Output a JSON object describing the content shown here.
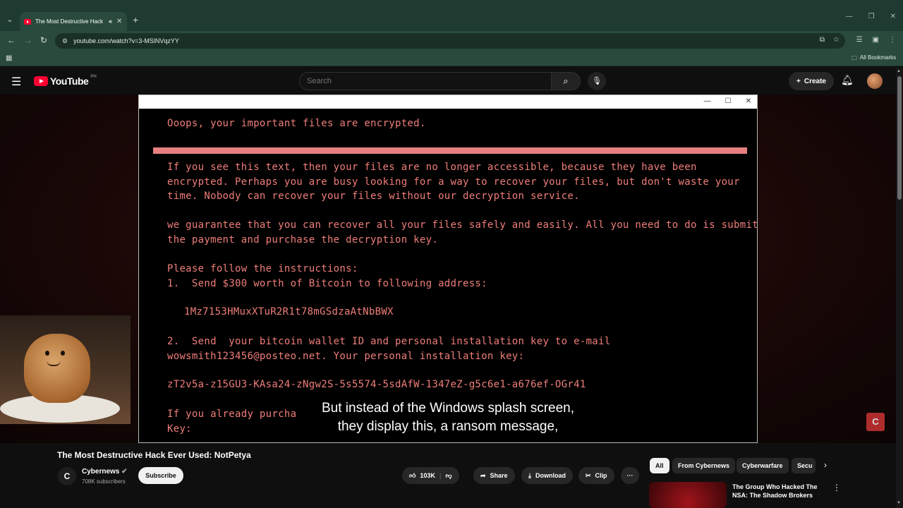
{
  "browser": {
    "tab_title": "The Most Destructive Hack",
    "url": "youtube.com/watch?v=3-MSlNVqzYY",
    "bookmarks_label": "All Bookmarks"
  },
  "youtube": {
    "logo_text": "YouTube",
    "country": "PH",
    "search_placeholder": "Search",
    "create_label": "Create"
  },
  "ransom": {
    "header": "Ooops, your important files are encrypted.",
    "p1": "If you see this text, then your files are no longer accessible, because they have been\nencrypted. Perhaps you are busy looking for a way to recover your files, but don't waste your\ntime. Nobody can recover your files without our decryption service.",
    "p2": "we guarantee that you can recover all your files safely and easily. All you need to do is submit\nthe payment and purchase the decryption key.",
    "p3": "Please follow the instructions:\n1.  Send $300 worth of Bitcoin to following address:",
    "address": "1Mz7153HMuxXTuR2R1t78mGSdzaAtNbBWX",
    "p4": "2.  Send  your bitcoin wallet ID and personal installation key to e-mail\nwowsmith123456@posteo.net. Your personal installation key:",
    "key": "zT2v5a-z15GU3-KAsa24-zNgw2S-5s5574-5sdAfW-1347eZ-g5c6e1-a676ef-OGr41",
    "p5": "If you already purcha\nKey:"
  },
  "subtitles": [
    "But instead of the Windows splash screen,",
    "they display this, a ransom message,"
  ],
  "video": {
    "title": "The Most Destructive Hack Ever Used: NotPetya",
    "channel": "Cybernews",
    "subscribers": "708K subscribers",
    "subscribe_label": "Subscribe",
    "likes": "103K",
    "share_label": "Share",
    "download_label": "Download",
    "clip_label": "Clip"
  },
  "chips": [
    "All",
    "From Cybernews",
    "Cyberwarfare",
    "Secu"
  ],
  "recommendation": {
    "title": "The Group Who Hacked The NSA: The Shadow Brokers"
  }
}
